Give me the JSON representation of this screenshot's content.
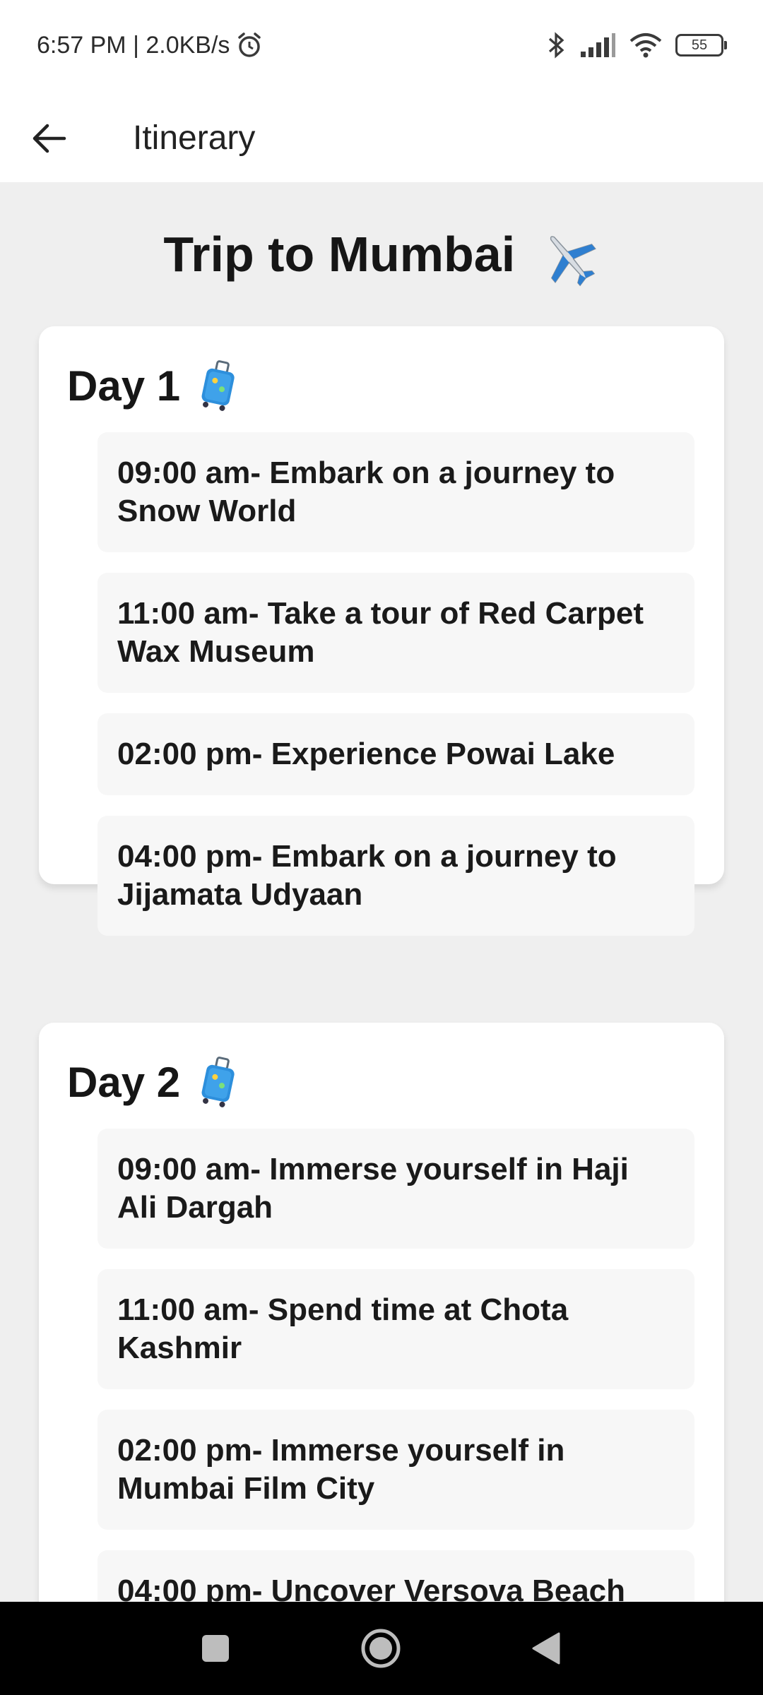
{
  "status_bar": {
    "time_speed": "6:57 PM | 2.0KB/s",
    "battery": "55",
    "icons": [
      "alarm-icon",
      "bluetooth-icon",
      "signal-icon",
      "wifi-icon",
      "battery-icon"
    ]
  },
  "app_bar": {
    "title": "Itinerary",
    "back_icon": "arrow-left-icon"
  },
  "trip": {
    "title": "Trip to Mumbai",
    "emoji": "airplane"
  },
  "days": [
    {
      "label": "Day 1",
      "emoji": "luggage",
      "activities": [
        "09:00 am- Embark on a journey to Snow World",
        "11:00 am- Take a tour of Red Carpet Wax Museum",
        "02:00 pm- Experience Powai Lake",
        "04:00 pm- Embark on a journey to Jijamata Udyaan"
      ]
    },
    {
      "label": "Day 2",
      "emoji": "luggage",
      "activities": [
        "09:00 am- Immerse yourself in Haji Ali Dargah",
        "11:00 am- Spend time at Chota Kashmir",
        "02:00 pm- Immerse yourself in Mumbai Film City",
        "04:00 pm- Uncover Versova Beach"
      ]
    }
  ],
  "nav_bar": {
    "buttons": [
      "recents-square-icon",
      "home-circle-icon",
      "back-triangle-icon"
    ]
  },
  "colors": {
    "background": "#efefef",
    "card": "#ffffff",
    "activity": "#f7f7f7",
    "nav_bar": "#000000",
    "airplane_blue": "#2f7fd0",
    "luggage_blue": "#2d8fdc"
  }
}
